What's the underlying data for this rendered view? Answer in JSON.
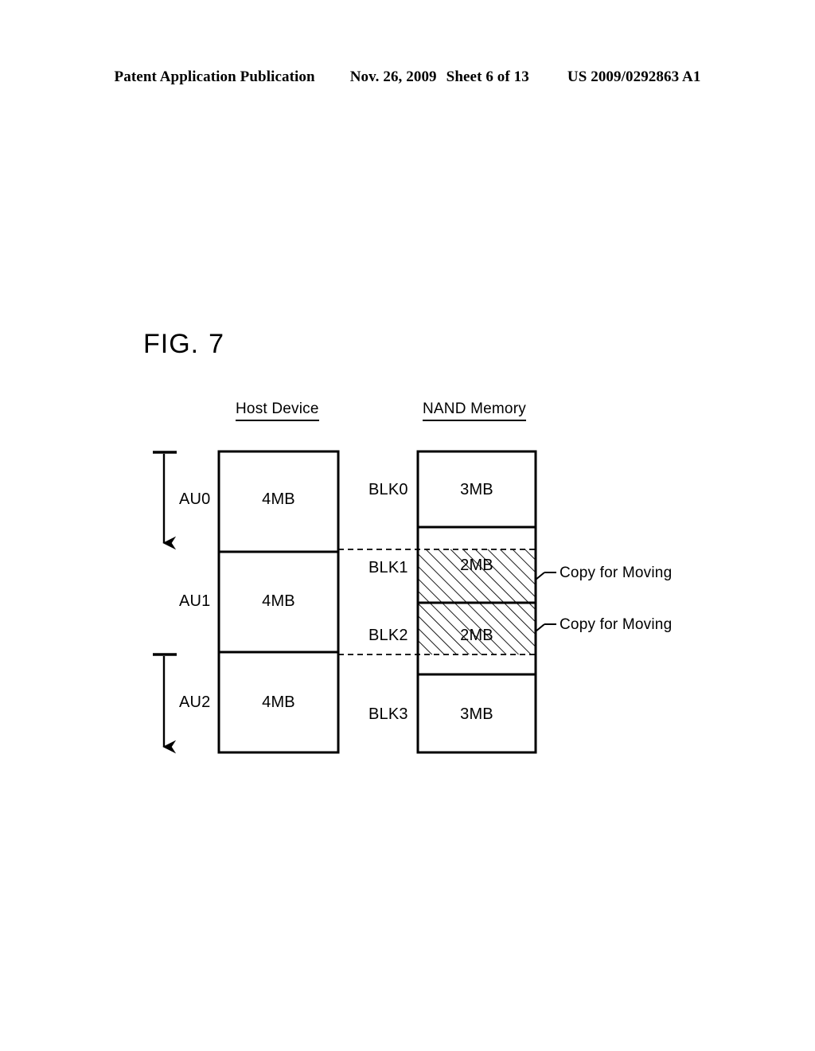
{
  "header": {
    "publication": "Patent Application Publication",
    "date": "Nov. 26, 2009",
    "sheet": "Sheet 6 of 13",
    "number": "US 2009/0292863 A1"
  },
  "figure": {
    "label": "FIG.",
    "number": "7"
  },
  "columns": {
    "host": {
      "heading": "Host Device"
    },
    "nand": {
      "heading": "NAND Memory"
    }
  },
  "host_units": [
    {
      "label": "AU0",
      "size": "4MB"
    },
    {
      "label": "AU1",
      "size": "4MB"
    },
    {
      "label": "AU2",
      "size": "4MB"
    }
  ],
  "nand_blocks": [
    {
      "label": "BLK0",
      "size": "3MB",
      "hatched": false
    },
    {
      "label": "BLK1",
      "size": "2MB",
      "hatched": true
    },
    {
      "label": "BLK2",
      "size": "2MB",
      "hatched": true
    },
    {
      "label": "BLK3",
      "size": "3MB",
      "hatched": false
    }
  ],
  "callouts": [
    {
      "text": "Copy for Moving"
    },
    {
      "text": "Copy for Moving"
    }
  ],
  "colors": {
    "ink": "#000000",
    "paper": "#ffffff"
  }
}
